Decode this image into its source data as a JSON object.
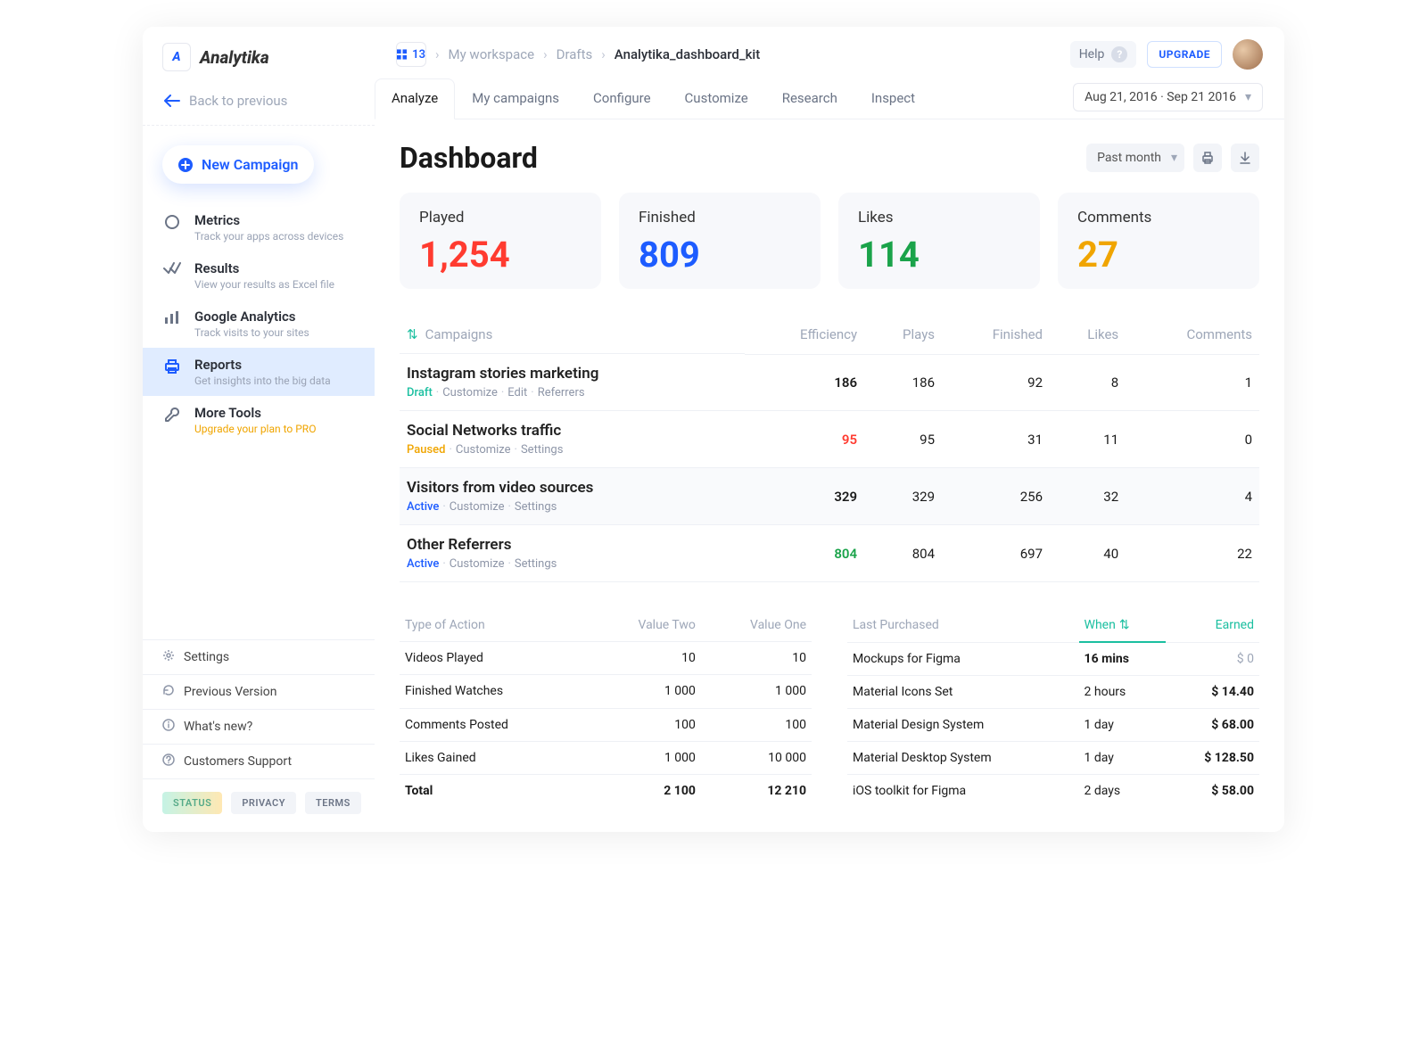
{
  "brand": "Analytika",
  "back_label": "Back to previous",
  "new_campaign": "New Campaign",
  "nav": [
    {
      "title": "Metrics",
      "sub": "Track your apps across devices",
      "pro": false,
      "icon": "circle"
    },
    {
      "title": "Results",
      "sub": "View your results as Excel file",
      "pro": false,
      "icon": "check"
    },
    {
      "title": "Google Analytics",
      "sub": "Track visits to your sites",
      "pro": false,
      "icon": "bars"
    },
    {
      "title": "Reports",
      "sub": "Get insights into the big data",
      "pro": false,
      "icon": "printer",
      "active": true
    },
    {
      "title": "More Tools",
      "sub": "Upgrade your plan to PRO",
      "pro": true,
      "icon": "wrench"
    }
  ],
  "footer_links": [
    "Settings",
    "Previous Version",
    "What's new?",
    "Customers Support"
  ],
  "badges": {
    "status": "STATUS",
    "privacy": "PRIVACY",
    "terms": "TERMS"
  },
  "breadcrumb": {
    "count": "13",
    "items": [
      "My workspace",
      "Drafts"
    ],
    "current": "Analytika_dashboard_kit"
  },
  "help": "Help",
  "upgrade": "UPGRADE",
  "tabs": [
    "Analyze",
    "My campaigns",
    "Configure",
    "Customize",
    "Research",
    "Inspect"
  ],
  "active_tab": "Analyze",
  "date_range": "Aug 21, 2016 · Sep 21 2016",
  "page_title": "Dashboard",
  "period": "Past month",
  "kpis": [
    {
      "label": "Played",
      "value": "1,254",
      "class": "c-red"
    },
    {
      "label": "Finished",
      "value": "809",
      "class": "c-blue"
    },
    {
      "label": "Likes",
      "value": "114",
      "class": "c-green"
    },
    {
      "label": "Comments",
      "value": "27",
      "class": "c-amber"
    }
  ],
  "camp_headers": [
    "Campaigns",
    "Efficiency",
    "Plays",
    "Finished",
    "Likes",
    "Comments"
  ],
  "campaigns": [
    {
      "name": "Instagram stories marketing",
      "status": "Draft",
      "status_cls": "status-draft",
      "meta": [
        "Customize",
        "Edit",
        "Referrers"
      ],
      "eff": "186",
      "eff_cls": "",
      "plays": "186",
      "finished": "92",
      "likes": "8",
      "comments": "1",
      "shade": false
    },
    {
      "name": "Social Networks traffic",
      "status": "Paused",
      "status_cls": "status-paused",
      "meta": [
        "Customize",
        "Settings"
      ],
      "eff": "95",
      "eff_cls": "c-red",
      "plays": "95",
      "finished": "31",
      "likes": "11",
      "comments": "0",
      "shade": false
    },
    {
      "name": "Visitors from video sources",
      "status": "Active",
      "status_cls": "status-active",
      "meta": [
        "Customize",
        "Settings"
      ],
      "eff": "329",
      "eff_cls": "",
      "plays": "329",
      "finished": "256",
      "likes": "32",
      "comments": "4",
      "shade": true
    },
    {
      "name": "Other Referrers",
      "status": "Active",
      "status_cls": "status-active",
      "meta": [
        "Customize",
        "Settings"
      ],
      "eff": "804",
      "eff_cls": "c-green",
      "plays": "804",
      "finished": "697",
      "likes": "40",
      "comments": "22",
      "shade": false
    }
  ],
  "actions_table": {
    "headers": [
      "Type of Action",
      "Value Two",
      "Value One"
    ],
    "rows": [
      [
        "Videos Played",
        "10",
        "10"
      ],
      [
        "Finished Watches",
        "1 000",
        "1 000"
      ],
      [
        "Comments Posted",
        "100",
        "100"
      ],
      [
        "Likes Gained",
        "1 000",
        "10 000"
      ]
    ],
    "total": [
      "Total",
      "2 100",
      "12 210"
    ]
  },
  "purchases_table": {
    "headers": [
      "Last Purchased",
      "When",
      "Earned"
    ],
    "rows": [
      [
        "Mockups for Figma",
        "16 mins",
        "$ 0"
      ],
      [
        "Material Icons Set",
        "2 hours",
        "$ 14.40"
      ],
      [
        "Material Design System",
        "1 day",
        "$ 68.00"
      ],
      [
        "Material Desktop System",
        "1 day",
        "$ 128.50"
      ],
      [
        "iOS toolkit for Figma",
        "2 days",
        "$ 58.00"
      ]
    ]
  }
}
